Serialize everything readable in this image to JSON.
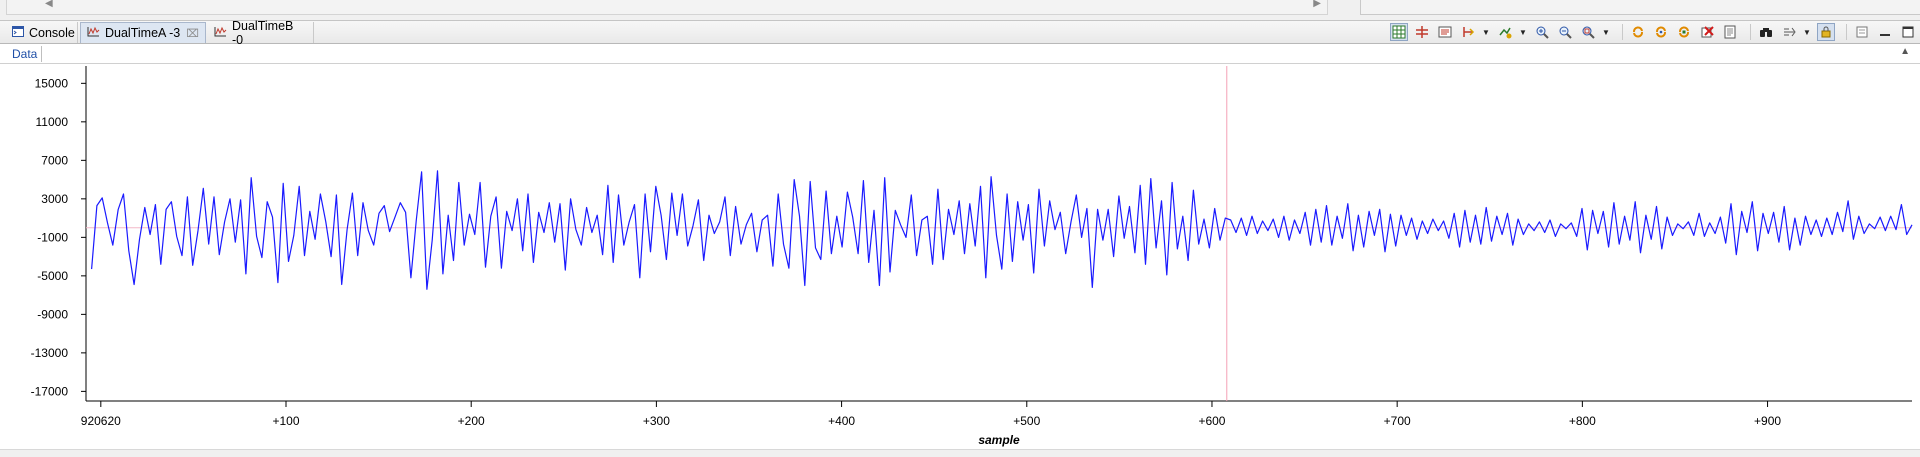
{
  "tabs": [
    {
      "label": "Console",
      "icon": "console-icon",
      "active": false,
      "closable": false
    },
    {
      "label": "DualTimeA -3",
      "icon": "graph-icon",
      "active": true,
      "closable": true
    },
    {
      "label": "DualTimeB -0",
      "icon": "graph-icon",
      "active": false,
      "closable": false
    }
  ],
  "toolbar_icons": [
    "grid-view-icon",
    "measure-icon",
    "chart-properties-icon",
    "marker-icon",
    "add-graph-icon",
    "zoom-in-icon",
    "zoom-out-icon",
    "zoom-fit-icon",
    "refresh-icon",
    "refresh-continuous-icon",
    "auto-refresh-icon",
    "clear-icon",
    "export-icon",
    "binoculars-icon",
    "pin-icon",
    "lock-icon",
    "minimize-icon",
    "maximize-icon"
  ],
  "data_header": {
    "label": "Data"
  },
  "colors": {
    "signal": "#1a1aff",
    "cursor": "#f4a0b4",
    "zero_line": "#f4b8c8"
  },
  "chart_data": {
    "type": "line",
    "title": "",
    "xlabel": "sample",
    "ylabel": "",
    "x_tick_labels": [
      "920620",
      "+100",
      "+200",
      "+300",
      "+400",
      "+500",
      "+600",
      "+700",
      "+800",
      "+900"
    ],
    "x_tick_values": [
      0,
      100,
      200,
      300,
      400,
      500,
      600,
      700,
      800,
      900
    ],
    "y_tick_labels": [
      "15000",
      "11000",
      "7000",
      "3000",
      "-1000",
      "-5000",
      "-9000",
      "-13000",
      "-17000"
    ],
    "y_tick_values": [
      15000,
      11000,
      7000,
      3000,
      -1000,
      -5000,
      -9000,
      -13000,
      -17000
    ],
    "xlim": [
      -8,
      978
    ],
    "ylim": [
      -18000,
      16800
    ],
    "cursor_x": 608,
    "grid": false,
    "series": [
      {
        "values": [
          -4300,
          2300,
          3100,
          500,
          -1800,
          1900,
          3500,
          -2400,
          -5900,
          -1200,
          2100,
          -700,
          2400,
          -3800,
          1900,
          2700,
          -900,
          -2900,
          3200,
          -3900,
          -300,
          4100,
          -1700,
          3200,
          -2800,
          600,
          3000,
          -1500,
          2900,
          -4800,
          5200,
          -900,
          -3100,
          2700,
          1100,
          -5700,
          4600,
          -3500,
          -800,
          4300,
          -2900,
          1700,
          -1200,
          3500,
          600,
          -3000,
          3400,
          -5900,
          -200,
          3600,
          -2900,
          2600,
          -300,
          -1800,
          1500,
          2300,
          -400,
          1100,
          2600,
          1600,
          -5200,
          800,
          5800,
          -6400,
          -1300,
          5900,
          -4800,
          1300,
          -3400,
          4700,
          -1800,
          1400,
          -700,
          4700,
          -4100,
          1200,
          3200,
          -4200,
          1700,
          -300,
          3000,
          -2400,
          3500,
          -3600,
          1600,
          -500,
          2600,
          -1500,
          2500,
          -4400,
          3000,
          -200,
          -1800,
          2100,
          -500,
          1300,
          -2800,
          4400,
          -3600,
          3400,
          -1800,
          600,
          2400,
          -5200,
          3500,
          -2500,
          4300,
          1300,
          -3300,
          3600,
          -800,
          3500,
          -1900,
          200,
          2900,
          -3400,
          1300,
          -600,
          600,
          3200,
          -2900,
          2200,
          -1700,
          300,
          1500,
          -2500,
          800,
          1300,
          -4000,
          3500,
          -1700,
          -4200,
          5000,
          1200,
          -6000,
          4800,
          -2100,
          -3300,
          3800,
          -2700,
          1200,
          -2000,
          3700,
          1100,
          -2700,
          4900,
          -3600,
          1800,
          -6000,
          5200,
          -4600,
          1800,
          300,
          -1000,
          3400,
          -2900,
          800,
          1200,
          -3800,
          4000,
          -3300,
          1900,
          -700,
          2800,
          -2700,
          2500,
          -1900,
          4300,
          -5200,
          5300,
          -800,
          -4300,
          3500,
          -3500,
          2700,
          -1300,
          2400,
          -4700,
          4000,
          -1900,
          2800,
          -200,
          1600,
          -2700,
          600,
          3400,
          -1000,
          2000,
          -6200,
          1900,
          -1300,
          1900,
          -3000,
          3300,
          -1100,
          2200,
          -2600,
          4400,
          -3800,
          5100,
          -2100,
          2800,
          -4900,
          4700,
          -2200,
          1200,
          -3400,
          3900,
          -1700,
          900,
          -2100,
          2000,
          -1300,
          1000,
          800,
          -500,
          1000,
          -800,
          1200,
          -600,
          700,
          -300,
          900,
          -1000,
          1200,
          -1300,
          800,
          -600,
          1600,
          -1800,
          1900,
          -1500,
          2300,
          -1800,
          1200,
          -1100,
          2500,
          -2400,
          1300,
          -2000,
          1700,
          -800,
          1900,
          -2500,
          1400,
          -1900,
          1300,
          -800,
          1000,
          -1200,
          700,
          -600,
          900,
          -300,
          700,
          -1100,
          1500,
          -2000,
          1800,
          -1500,
          1300,
          -1700,
          2100,
          -1400,
          1200,
          -700,
          1500,
          -1800,
          900,
          -700,
          400,
          -300,
          600,
          -500,
          800,
          -900,
          400,
          -100,
          500,
          -900,
          2000,
          -2300,
          1800,
          -600,
          1700,
          -2000,
          2600,
          -1700,
          1200,
          -1300,
          2700,
          -2600,
          1300,
          -1200,
          2200,
          -2200,
          1100,
          -800,
          400,
          -100,
          600,
          -800,
          1500,
          -900,
          500,
          -600,
          1100,
          -1600,
          2500,
          -2800,
          1700,
          -500,
          2700,
          -2400,
          1500,
          -600,
          1600,
          -1500,
          2200,
          -2300,
          1000,
          -1800,
          1200,
          -700,
          800,
          -900,
          1000,
          -700,
          1600,
          -400,
          2800,
          -1200,
          1200,
          -600,
          400,
          -100,
          1100,
          -300,
          1200,
          -200,
          2400,
          -700,
          300
        ]
      }
    ]
  }
}
